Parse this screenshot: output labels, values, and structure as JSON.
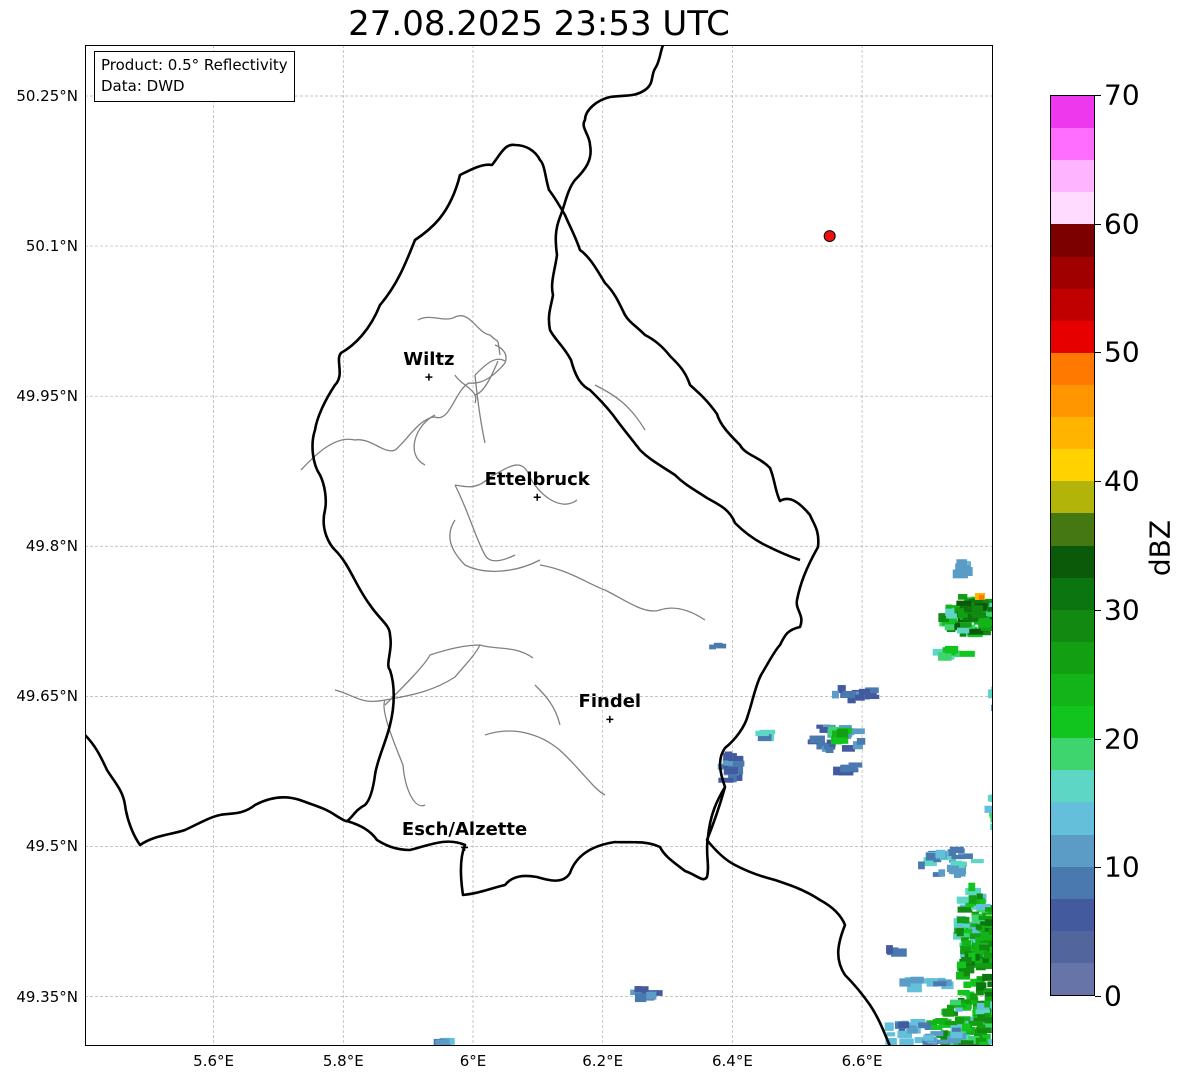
{
  "title": "27.08.2025 23:53 UTC",
  "info": {
    "product": "Product: 0.5° Reflectivity",
    "data": "Data: DWD"
  },
  "lat_labels": [
    "50.25°N",
    "50.1°N",
    "49.95°N",
    "49.8°N",
    "49.65°N",
    "49.5°N",
    "49.35°N"
  ],
  "lon_labels": [
    "5.6°E",
    "5.8°E",
    "6°E",
    "6.2°E",
    "6.4°E",
    "6.6°E"
  ],
  "cities": [
    {
      "name": "Wiltz",
      "lat": 49.969,
      "lon": 5.932
    },
    {
      "name": "Ettelbruck",
      "lat": 49.849,
      "lon": 6.099
    },
    {
      "name": "Findel",
      "lat": 49.627,
      "lon": 6.211
    },
    {
      "name": "Esch/Alzette",
      "lat": 49.499,
      "lon": 5.987
    }
  ],
  "marker": {
    "lat": 50.11,
    "lon": 6.55,
    "color": "#ee1111"
  },
  "colorbar": {
    "label": "dBZ",
    "min": 0,
    "max": 70,
    "tick_labels": [
      "0",
      "10",
      "20",
      "30",
      "40",
      "50",
      "60",
      "70"
    ],
    "colors": [
      "#6674a8",
      "#52659d",
      "#435a9f",
      "#4a79b0",
      "#5b9cc6",
      "#64bfdb",
      "#5ed6c6",
      "#3ed46e",
      "#12c41e",
      "#12b41a",
      "#12a012",
      "#128a12",
      "#0b760f",
      "#0a5a0a",
      "#457812",
      "#b2b40a",
      "#ffd200",
      "#ffb400",
      "#ff9600",
      "#ff7800",
      "#e60000",
      "#c00000",
      "#a00000",
      "#7c0000",
      "#ffdcff",
      "#ffb4ff",
      "#ff6eff",
      "#ee38ee"
    ]
  },
  "map_extent": {
    "lon_min": 5.4,
    "lon_max": 6.8,
    "lat_min": 49.3,
    "lat_max": 50.3
  }
}
